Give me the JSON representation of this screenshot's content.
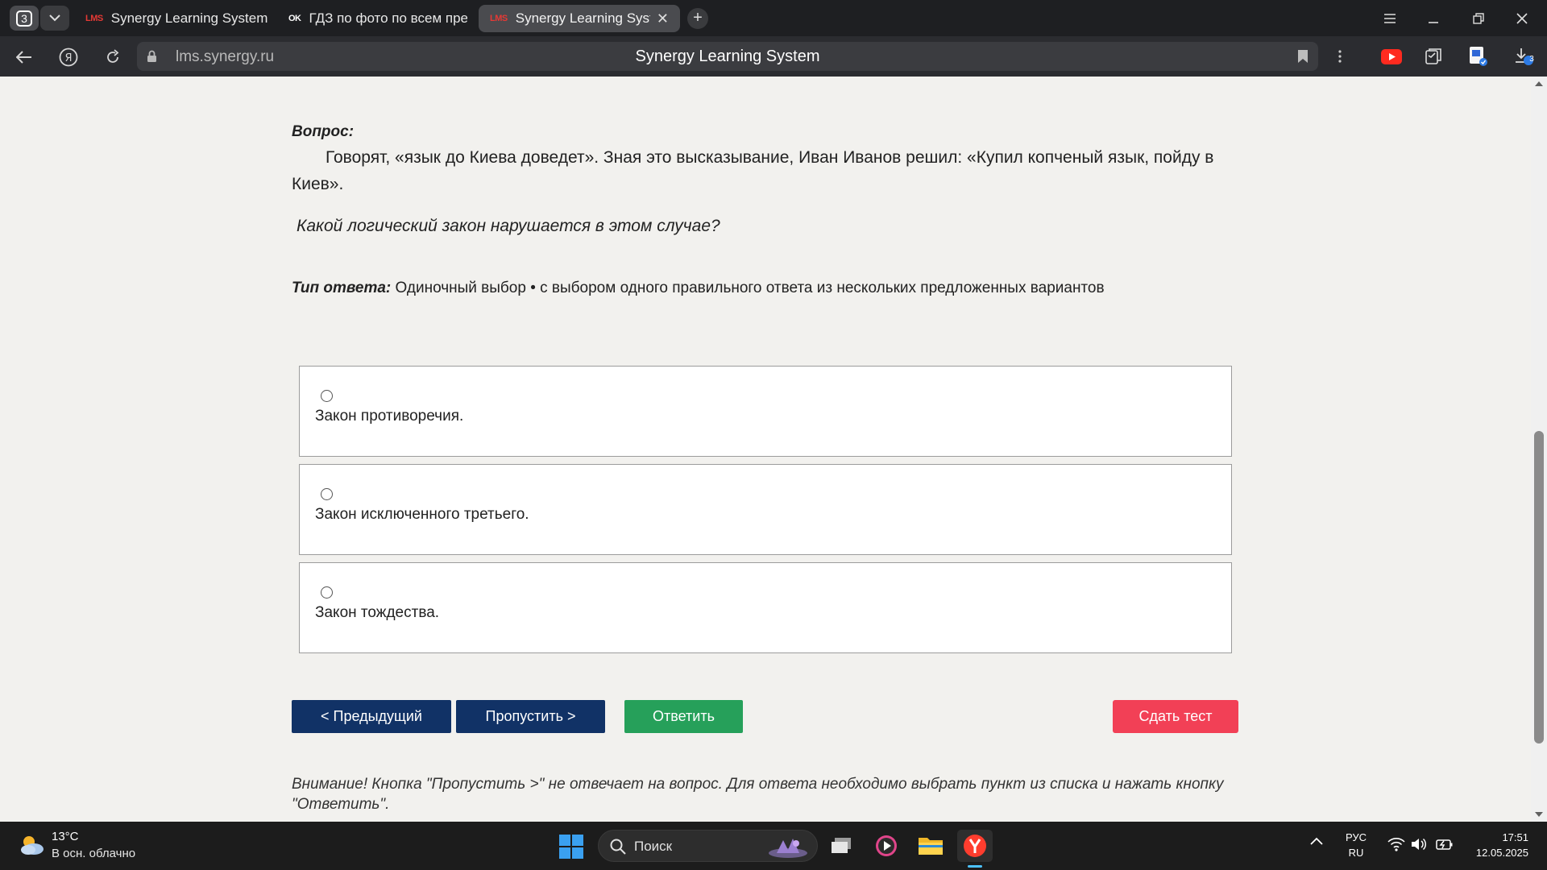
{
  "browser": {
    "tab_count": "3",
    "tabs": [
      {
        "favicon": "LMS",
        "title": "Synergy Learning System",
        "active": false
      },
      {
        "favicon": "OK",
        "title": "ГДЗ по фото по всем пред",
        "active": false
      },
      {
        "favicon": "LMS",
        "title": "Synergy Learning Syste",
        "active": true
      }
    ],
    "url_domain": "lms.synergy.ru",
    "page_title": "Synergy Learning System",
    "downloads_badge": "3"
  },
  "question": {
    "label": "Вопрос:",
    "text": "Говорят, «язык до Киева доведет». Зная это высказывание, Иван Иванов решил: «Купил копченый язык, пойду в Киев».",
    "ask": "Какой логический закон нарушается в этом случае?",
    "answer_type_label": "Тип ответа:",
    "answer_type_value": " Одиночный выбор • с выбором одного правильного ответа из нескольких предложенных вариантов"
  },
  "options": [
    {
      "label": "Закон противоречия.",
      "selected": false
    },
    {
      "label": "Закон исключенного третьего.",
      "selected": false
    },
    {
      "label": "Закон тождества.",
      "selected": false
    }
  ],
  "buttons": {
    "prev": "< Предыдущий",
    "skip": "Пропустить >",
    "answer": "Ответить",
    "submit": "Сдать тест"
  },
  "note": "Внимание! Кнопка \"Пропустить >\" не отвечает на вопрос. Для ответа необходимо выбрать пункт из списка и нажать кнопку \"Ответить\".",
  "colors": {
    "nav_button": "#113266",
    "answer_button": "#26a05a",
    "submit_button": "#f24056",
    "page_background": "#f2f1ee"
  },
  "taskbar": {
    "weather_temp": "13°C",
    "weather_desc": "В осн. облачно",
    "search_placeholder": "Поиск",
    "lang_top": "РУС",
    "lang_bottom": "RU",
    "time": "17:51",
    "date": "12.05.2025"
  }
}
